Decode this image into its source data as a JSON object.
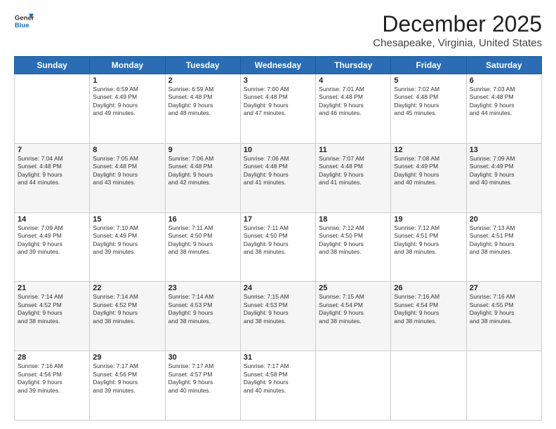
{
  "header": {
    "logo_line1": "General",
    "logo_line2": "Blue",
    "title": "December 2025",
    "subtitle": "Chesapeake, Virginia, United States"
  },
  "weekdays": [
    "Sunday",
    "Monday",
    "Tuesday",
    "Wednesday",
    "Thursday",
    "Friday",
    "Saturday"
  ],
  "weeks": [
    [
      {
        "day": "",
        "text": ""
      },
      {
        "day": "1",
        "text": "Sunrise: 6:59 AM\nSunset: 4:49 PM\nDaylight: 9 hours\nand 49 minutes."
      },
      {
        "day": "2",
        "text": "Sunrise: 6:59 AM\nSunset: 4:48 PM\nDaylight: 9 hours\nand 48 minutes."
      },
      {
        "day": "3",
        "text": "Sunrise: 7:00 AM\nSunset: 4:48 PM\nDaylight: 9 hours\nand 47 minutes."
      },
      {
        "day": "4",
        "text": "Sunrise: 7:01 AM\nSunset: 4:48 PM\nDaylight: 9 hours\nand 46 minutes."
      },
      {
        "day": "5",
        "text": "Sunrise: 7:02 AM\nSunset: 4:48 PM\nDaylight: 9 hours\nand 45 minutes."
      },
      {
        "day": "6",
        "text": "Sunrise: 7:03 AM\nSunset: 4:48 PM\nDaylight: 9 hours\nand 44 minutes."
      }
    ],
    [
      {
        "day": "7",
        "text": "Sunrise: 7:04 AM\nSunset: 4:48 PM\nDaylight: 9 hours\nand 44 minutes."
      },
      {
        "day": "8",
        "text": "Sunrise: 7:05 AM\nSunset: 4:48 PM\nDaylight: 9 hours\nand 43 minutes."
      },
      {
        "day": "9",
        "text": "Sunrise: 7:06 AM\nSunset: 4:48 PM\nDaylight: 9 hours\nand 42 minutes."
      },
      {
        "day": "10",
        "text": "Sunrise: 7:06 AM\nSunset: 4:48 PM\nDaylight: 9 hours\nand 41 minutes."
      },
      {
        "day": "11",
        "text": "Sunrise: 7:07 AM\nSunset: 4:48 PM\nDaylight: 9 hours\nand 41 minutes."
      },
      {
        "day": "12",
        "text": "Sunrise: 7:08 AM\nSunset: 4:49 PM\nDaylight: 9 hours\nand 40 minutes."
      },
      {
        "day": "13",
        "text": "Sunrise: 7:09 AM\nSunset: 4:49 PM\nDaylight: 9 hours\nand 40 minutes."
      }
    ],
    [
      {
        "day": "14",
        "text": "Sunrise: 7:09 AM\nSunset: 4:49 PM\nDaylight: 9 hours\nand 39 minutes."
      },
      {
        "day": "15",
        "text": "Sunrise: 7:10 AM\nSunset: 4:49 PM\nDaylight: 9 hours\nand 39 minutes."
      },
      {
        "day": "16",
        "text": "Sunrise: 7:11 AM\nSunset: 4:50 PM\nDaylight: 9 hours\nand 38 minutes."
      },
      {
        "day": "17",
        "text": "Sunrise: 7:11 AM\nSunset: 4:50 PM\nDaylight: 9 hours\nand 38 minutes."
      },
      {
        "day": "18",
        "text": "Sunrise: 7:12 AM\nSunset: 4:50 PM\nDaylight: 9 hours\nand 38 minutes."
      },
      {
        "day": "19",
        "text": "Sunrise: 7:12 AM\nSunset: 4:51 PM\nDaylight: 9 hours\nand 38 minutes."
      },
      {
        "day": "20",
        "text": "Sunrise: 7:13 AM\nSunset: 4:51 PM\nDaylight: 9 hours\nand 38 minutes."
      }
    ],
    [
      {
        "day": "21",
        "text": "Sunrise: 7:14 AM\nSunset: 4:52 PM\nDaylight: 9 hours\nand 38 minutes."
      },
      {
        "day": "22",
        "text": "Sunrise: 7:14 AM\nSunset: 4:52 PM\nDaylight: 9 hours\nand 38 minutes."
      },
      {
        "day": "23",
        "text": "Sunrise: 7:14 AM\nSunset: 4:53 PM\nDaylight: 9 hours\nand 38 minutes."
      },
      {
        "day": "24",
        "text": "Sunrise: 7:15 AM\nSunset: 4:53 PM\nDaylight: 9 hours\nand 38 minutes."
      },
      {
        "day": "25",
        "text": "Sunrise: 7:15 AM\nSunset: 4:54 PM\nDaylight: 9 hours\nand 38 minutes."
      },
      {
        "day": "26",
        "text": "Sunrise: 7:16 AM\nSunset: 4:54 PM\nDaylight: 9 hours\nand 38 minutes."
      },
      {
        "day": "27",
        "text": "Sunrise: 7:16 AM\nSunset: 4:55 PM\nDaylight: 9 hours\nand 38 minutes."
      }
    ],
    [
      {
        "day": "28",
        "text": "Sunrise: 7:16 AM\nSunset: 4:56 PM\nDaylight: 9 hours\nand 39 minutes."
      },
      {
        "day": "29",
        "text": "Sunrise: 7:17 AM\nSunset: 4:56 PM\nDaylight: 9 hours\nand 39 minutes."
      },
      {
        "day": "30",
        "text": "Sunrise: 7:17 AM\nSunset: 4:57 PM\nDaylight: 9 hours\nand 40 minutes."
      },
      {
        "day": "31",
        "text": "Sunrise: 7:17 AM\nSunset: 4:58 PM\nDaylight: 9 hours\nand 40 minutes."
      },
      {
        "day": "",
        "text": ""
      },
      {
        "day": "",
        "text": ""
      },
      {
        "day": "",
        "text": ""
      }
    ]
  ]
}
